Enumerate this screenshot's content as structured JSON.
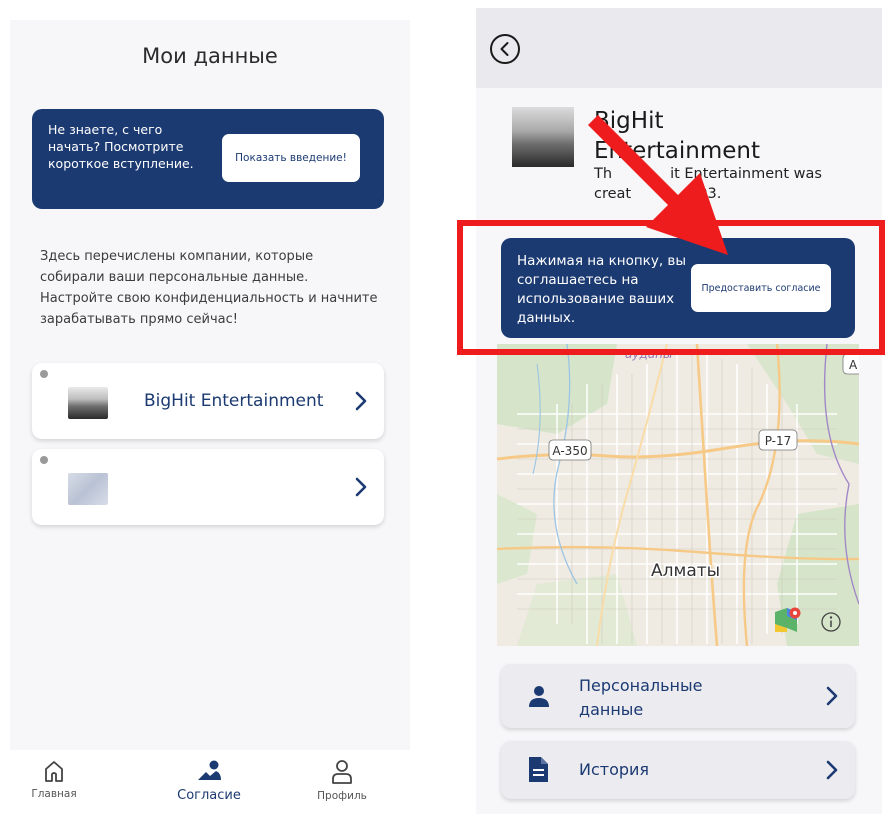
{
  "my_data_screen": {
    "title": "Мои данные",
    "intro_text": "Не знаете, с чего начать? Посмотрите короткое вступление.",
    "intro_button": "Показать введение!",
    "description": "Здесь перечислены компании, которые собирали ваши персональные данные. Настройте свою конфиденциальность и начните зарабатывать прямо сейчас!",
    "companies": [
      {
        "name": "BigHit Entertainment"
      },
      {
        "name": ""
      }
    ],
    "nav": [
      {
        "label": "Главная",
        "icon": "home-icon"
      },
      {
        "label": "Согласие",
        "icon": "consent-icon"
      },
      {
        "label": "Профиль",
        "icon": "profile-icon"
      }
    ]
  },
  "company_screen": {
    "company_name": "BigHit Entertainment",
    "description_visible_start": "Th",
    "description_visible_end": "it Entertainment was creat",
    "description_visible_tail": "393.",
    "consent_text": "Нажимая на кнопку, вы соглашаетесь на использование ваших данных.",
    "consent_button": "Предоставить согласие",
    "map_labels": {
      "district": "ауданы",
      "road_a350": "A-350",
      "road_p17": "P-17",
      "edge": "A",
      "city": "Алматы"
    },
    "menu": [
      {
        "label": "Персональные данные",
        "icon": "person-icon"
      },
      {
        "label": "История",
        "icon": "document-icon"
      }
    ]
  },
  "colors": {
    "primary": "#1c3a72",
    "highlight": "#ee1c1c"
  }
}
